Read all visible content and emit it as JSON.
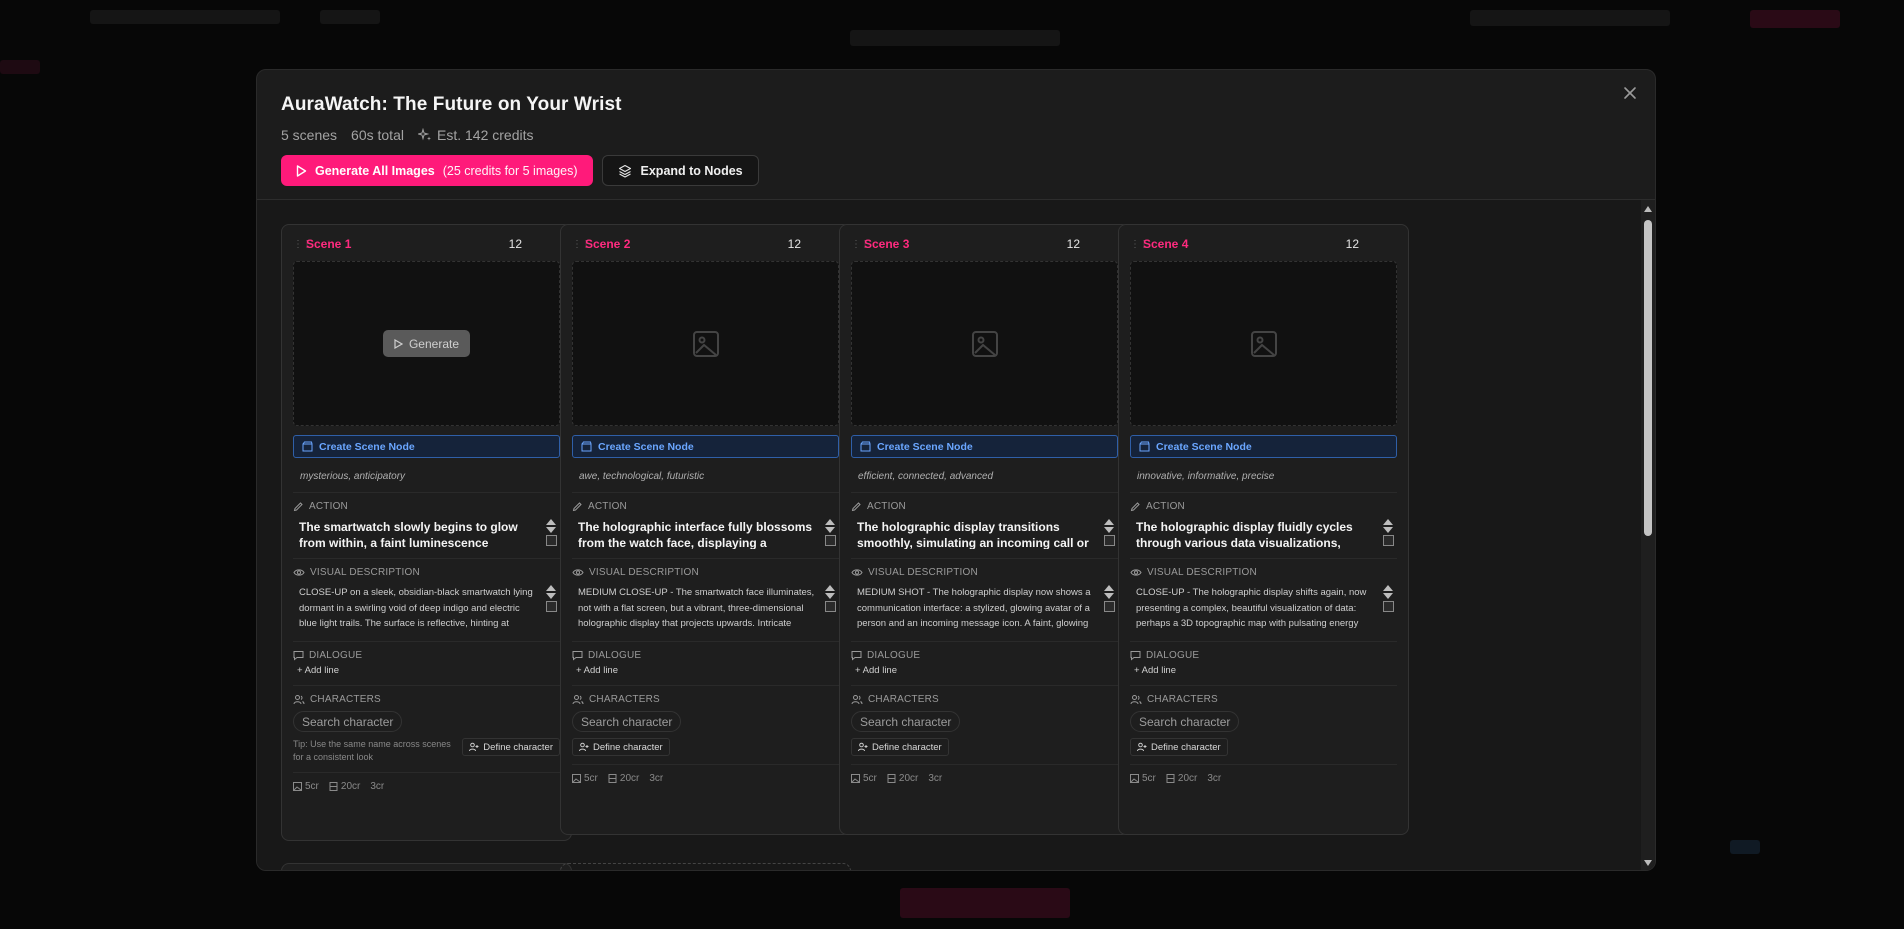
{
  "modal": {
    "title": "AuraWatch: The Future on Your Wrist",
    "scenes_count": "5 scenes",
    "total_duration": "60s total",
    "est_credits": "Est. 142 credits",
    "generate_all_label": "Generate All Images",
    "generate_all_sub": "(25 credits for 5 images)",
    "expand_label": "Expand to Nodes"
  },
  "labels": {
    "create_scene_node": "Create Scene Node",
    "action": "ACTION",
    "visual_description": "VISUAL DESCRIPTION",
    "dialogue": "DIALOGUE",
    "add_line": "+ Add line",
    "characters": "CHARACTERS",
    "define_character": "Define character",
    "tip": "Tip: Use the same name across scenes for a consistent look",
    "generate": "Generate"
  },
  "search_placeholder": "Search character",
  "scenes": [
    {
      "label": "Scene 1",
      "duration": "12",
      "mood": "mysterious, anticipatory",
      "action": "The smartwatch slowly begins to glow from within, a faint luminescence growing along its bezel and",
      "visual": "CLOSE-UP on a sleek, obsidian-black smartwatch lying dormant in a swirling void of deep indigo and electric blue light trails. The surface is reflective, hinting at",
      "cost_image": "5cr",
      "cost_video": "20cr",
      "cost_audio": "3cr"
    },
    {
      "label": "Scene 2",
      "duration": "12",
      "mood": "awe, technological, futuristic",
      "action": "The holographic interface fully blossoms from the watch face, displaying a dynamic, multi-layered visualization",
      "visual": "MEDIUM CLOSE-UP - The smartwatch face illuminates, not with a flat screen, but a vibrant, three-dimensional holographic display that projects upwards. Intricate neon",
      "cost_image": "5cr",
      "cost_video": "20cr",
      "cost_audio": "3cr"
    },
    {
      "label": "Scene 3",
      "duration": "12",
      "mood": "efficient, connected, advanced",
      "action": "The holographic display transitions smoothly, simulating an incoming call or message, revealing a",
      "visual": "MEDIUM SHOT - The holographic display now shows a communication interface: a stylized, glowing avatar of a person and an incoming message icon. A faint, glowing",
      "cost_image": "5cr",
      "cost_video": "20cr",
      "cost_audio": "3cr"
    },
    {
      "label": "Scene 4",
      "duration": "12",
      "mood": "innovative, informative, precise",
      "action": "The holographic display fluidly cycles through various data visualizations, showcasing the watch's abilities",
      "visual": "CLOSE-UP - The holographic display shifts again, now presenting a complex, beautiful visualization of data: perhaps a 3D topographic map with pulsating energy",
      "cost_image": "5cr",
      "cost_video": "20cr",
      "cost_audio": "3cr"
    }
  ],
  "colors": {
    "accent": "#ff1a7a",
    "scene_label": "#ff2a7f",
    "node_blue": "#6aa6ff",
    "background": "#1c1c1c"
  }
}
